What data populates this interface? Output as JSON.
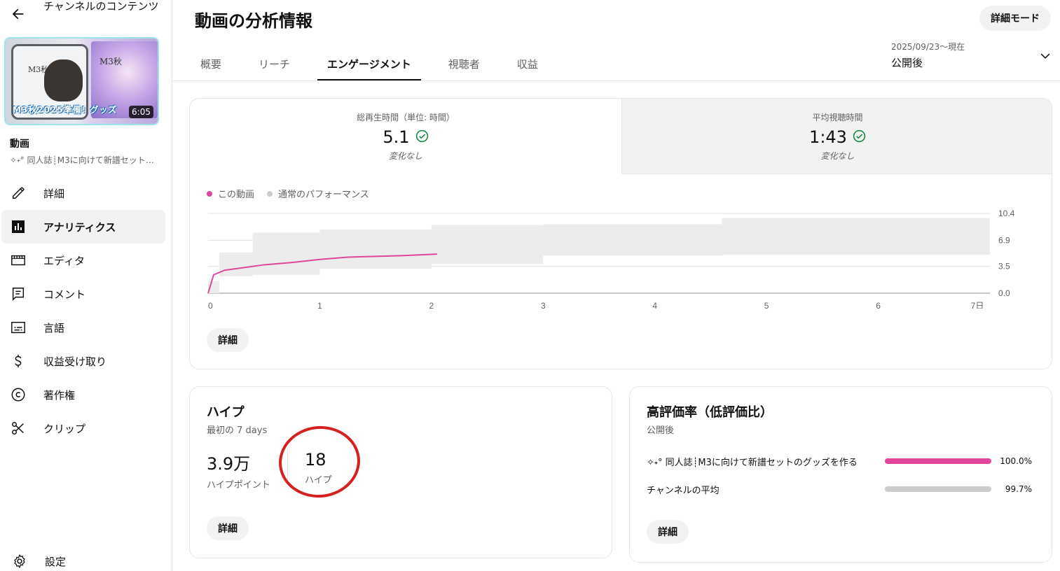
{
  "sidebar": {
    "back_title": "チャンネルのコンテンツ",
    "video": {
      "banner": "M3秋2025準備! グッズ",
      "thumb_left_text": "M3秋",
      "thumb_right_text": "M3秋",
      "duration": "6:05",
      "label": "動画",
      "title": "✧˖° 同人誌┊M3に向けて新譜セットのグッズを作る"
    },
    "items": [
      {
        "label": "詳細",
        "icon": "pencil-icon"
      },
      {
        "label": "アナリティクス",
        "icon": "analytics-icon",
        "active": true
      },
      {
        "label": "エディタ",
        "icon": "editor-icon"
      },
      {
        "label": "コメント",
        "icon": "comment-icon"
      },
      {
        "label": "言語",
        "icon": "subtitles-icon"
      },
      {
        "label": "収益受け取り",
        "icon": "dollar-icon"
      },
      {
        "label": "著作権",
        "icon": "copyright-icon"
      },
      {
        "label": "クリップ",
        "icon": "scissors-icon"
      }
    ],
    "settings_label": "設定"
  },
  "header": {
    "title": "動画の分析情報",
    "detail_mode": "詳細モード",
    "tabs": [
      "概要",
      "リーチ",
      "エンゲージメント",
      "視聴者",
      "収益"
    ],
    "active_tab": 2,
    "date_range": "2025/09/23〜現在",
    "period": "公開後"
  },
  "metrics": [
    {
      "label": "総再生時間（単位: 時間）",
      "value": "5.1",
      "change": "変化なし"
    },
    {
      "label": "平均視聴時間",
      "value": "1:43",
      "change": "変化なし"
    }
  ],
  "legend": [
    {
      "label": "この動画",
      "color": "#e0459b"
    },
    {
      "label": "通常のパフォーマンス",
      "color": "#cccccc"
    }
  ],
  "chart_data": {
    "type": "line",
    "x_ticks": [
      "0",
      "1",
      "2",
      "3",
      "4",
      "5",
      "6",
      "7日"
    ],
    "y_ticks": [
      "0.0",
      "3.5",
      "6.9",
      "10.4"
    ],
    "ylim": [
      0,
      10.4
    ],
    "xlim": [
      0,
      7
    ],
    "series": [
      {
        "name": "この動画",
        "color": "#e0459b",
        "x": [
          0,
          0.05,
          0.15,
          0.3,
          0.5,
          0.75,
          1.0,
          1.25,
          1.5,
          1.75,
          2.05
        ],
        "y": [
          0.0,
          2.4,
          3.0,
          3.3,
          3.7,
          4.0,
          4.4,
          4.7,
          4.8,
          4.9,
          5.1
        ]
      },
      {
        "name": "通常のパフォーマンス",
        "type": "band",
        "color": "#ececec",
        "x": [
          0,
          0.1,
          0.4,
          1.0,
          2.0,
          3.0,
          4.6,
          7.0
        ],
        "low": [
          0.0,
          1.6,
          2.2,
          2.4,
          3.2,
          3.8,
          4.9,
          5.0
        ],
        "high": [
          0.0,
          5.3,
          7.9,
          8.3,
          8.9,
          9.0,
          9.8,
          10.0
        ]
      }
    ],
    "grid": true,
    "legend_position": "top-left"
  },
  "detail_label": "詳細",
  "hype": {
    "title": "ハイプ",
    "subtitle": "最初の 7 days",
    "points_value": "3.9万",
    "points_label": "ハイプポイント",
    "count_value": "18",
    "count_label": "ハイプ"
  },
  "like_ratio": {
    "title": "高評価率（低評価比）",
    "subtitle": "公開後",
    "rows": [
      {
        "label": "✧˖° 同人誌┊M3に向けて新譜セットのグッズを作る",
        "value": "100.0%",
        "fraction": 1.0,
        "color": "#e0459b"
      },
      {
        "label": "チャンネルの平均",
        "value": "99.7%",
        "fraction": 0.997,
        "color": "#cccccc"
      }
    ]
  }
}
